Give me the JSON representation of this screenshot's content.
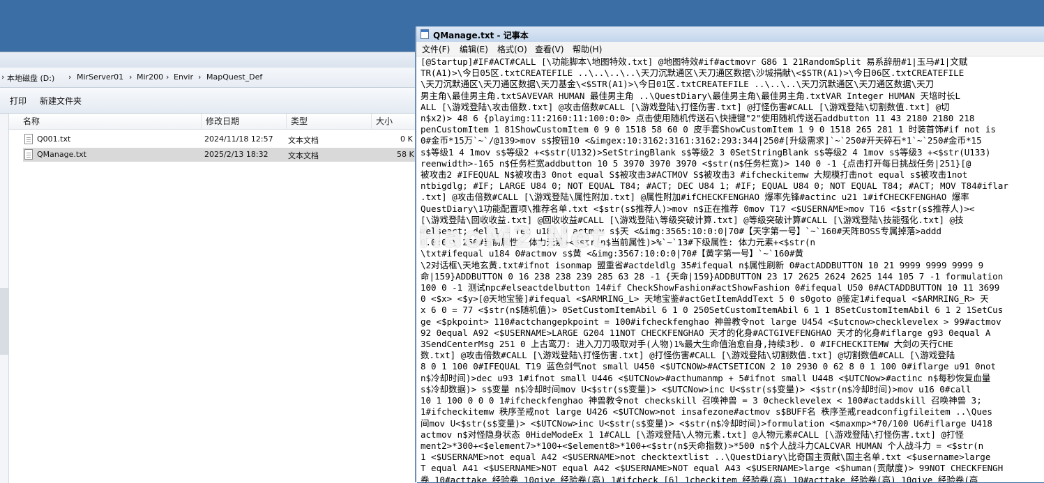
{
  "explorer": {
    "breadcrumb": [
      "本地磁盘 (D:)",
      "MirServer01",
      "Mir200",
      "Envir",
      "MapQuest_Def"
    ],
    "toolbar": {
      "print": "打印",
      "new_folder": "新建文件夹"
    },
    "columns": {
      "name": "名称",
      "date": "修改日期",
      "type": "类型",
      "size": "大小"
    },
    "files": [
      {
        "name": "Q001.txt",
        "date": "2024/11/18 12:57",
        "type": "文本文档",
        "size": "0 K"
      },
      {
        "name": "QManage.txt",
        "date": "2025/2/13 18:32",
        "type": "文本文档",
        "size": "58 K"
      }
    ]
  },
  "notepad": {
    "title": "QManage.txt - 记事本",
    "menu": [
      "文件(F)",
      "编辑(E)",
      "格式(O)",
      "查看(V)",
      "帮助(H)"
    ],
    "lines": [
      "[@Startup]#IF#ACT#CALL [\\功能脚本\\地图特效.txt] @地图特效#if#actmovr G86 1 21RandomSplit 易系辞册#1|玉马#1|文赋",
      "TR(A1)>\\今日05区.txtCREATEFILE ..\\..\\..\\..\\天刀沉默通区\\天刀通区数据\\沙城捐献\\<$STR(A1)>\\今日06区.txtCREATEFILE",
      "\\天刀沉默通区\\天刀通区数据\\天刀基金\\<$STR(A1)>\\今日01区.txtCREATEFILE ..\\..\\..\\天刀沉默通区\\天刀通区数据\\天刀",
      "男主角\\最佳男主角.txtSAVEVAR HUMAN 最佳男主角 ..\\QuestDiary\\最佳男主角\\最佳男主角.txtVAR Integer HUMAN 天培时长L",
      "ALL [\\游戏登陆\\攻击倍数.txt] @攻击倍数#CALL [\\游戏登陆\\打怪伤害.txt] @打怪伤害#CALL [\\游戏登陆\\切割数值.txt] @切",
      "n$x2)> 48 6 {playimg:11:2160:11:100:0:0> 点击使用随机传送石\\快捷键\"2\"使用随机传送石addbutton 11 43 2180 2180 218",
      "penCustomItem 1 81ShowCustomItem 0 9 0 1518 58 60 0 皮手套ShowCustomItem 1 9 0 1518 265 281 1 时装首饰#if not is",
      "0#金币*15万`~`/@139>mov s$按钮10 <&imgex:10:3162:3161:3162:293:344|250#[升级需求]`~`250#开天碎石*1`~`250#金币*15",
      "s$等级1 4 1mov s$等级2 +<$str(U132)>SetStringBlank s$等级2 3 0SetStringBlank s$等级2 4 1mov s$等级3 +<$str(U133)",
      "reenwidth>-165 n$任务栏宽addbutton 10 5 3970 3970 3970 <$str(n$任务栏宽)> 140 0 -1 {点击打开每日挑战任务|251}[@",
      "被攻击2 #IFEQUAL N$被攻击3 0not equal S$被攻击3#ACTMOV S$被攻击3 #ifcheckitemw 大规模打击not equal s$被攻击1not",
      "ntbigdlg; #IF; LARGE U84 0; NOT EQUAL T84; #ACT; DEC U84 1; #IF; EQUAL U84 0; NOT EQUAL T84; #ACT; MOV T84#iflar",
      ".txt] @攻击倍数#CALL [\\游戏登陆\\属性附加.txt] @属性附加#ifCHECKFENGHAO 爆率先锋#actinc u21 1#ifCHECKFENGHAO 爆率",
      "QuestDiary\\1功能配置项\\推荐名单.txt <$str(s$推荐人)>mov n$正在推荐 0mov T17 <$USERNAME>mov T16 <$str(s$推荐人)><",
      "[\\游戏登陆\\回收收益.txt] @回收收益#CALL [\\游戏登陆\\等级突破计算.txt] @等级突破计算#CALL [\\游戏登陆\\技能强化.txt] @技",
      "#elseact; del 1 4 fec u181 0 actmov s$天 <&img:3565:10:0:0|70#【天字第一号】`~`160#天阵BOSS专属掉落>addd",
      "0.0:0 \\ 250#当前属性: 体力元素+<$str(n$当前属性)>%`~`13#下级属性: 体力元素+<$str(n",
      "\\txt#ifequal u184 0#actmov s$黄 <&img:3567:10:0:0|70#【黄字第一号】`~`160#黄",
      "\\2对话框\\天地玄黄.txt#ifnot isonmap 盟重省#actdeldlg 35#ifequal n$属性刷新 0#actADDBUTTON 10 21 9999 9999 9999 9",
      "命|159}ADDBUTTON 0 16 238 238 239 285 63 28 -1 {天命|159}ADDBUTTON 23 17 2625 2624 2625 144 105 7 -1 formulation",
      "100 0 -1 测试npc#elseactdelbutton 14#if CheckShowFashion#actShowFashion 0#ifequal U50 0#ACTADDBUTTON 10 11 3699",
      "0 <$x> <$y>[@天地宝鉴]#ifequal <$ARMRING_L> 天地宝鉴#actGetItemAddText 5 0 s0goto @鉴定1#ifequal <$ARMRING_R> 天",
      "x 6 0 = 77 <$str(n$随机值)> 0SetCustomItemAbil 6 1 0 250SetCustomItemAbil 6 1 1 8SetCustomItemAbil 6 1 2 1SetCus",
      "ge <$pkpoint> 110#actchangepkpoint = 100#ifcheckfenghao 神兽教令not large U454 <$utcnow>checklevelex > 99#actmov",
      "92 0equal A92 <$USERNAME>LARGE G204 11NOT CHECKFENGHAO 天才的化身#ACTGIVEFENGHAO 天才的化身#iflarge g93 0equal A",
      "3SendCenterMsg 251 0 上古鸾刀: 进入刀刀吸取对手(人物)1%最大生命值治愈自身,持续3秒. 0 #IFCHECKITEMW 大剑の天行CHE",
      "数.txt] @攻击倍数#CALL [\\游戏登陆\\打怪伤害.txt] @打怪伤害#CALL [\\游戏登陆\\切割数值.txt] @切割数值#CALL [\\游戏登陆",
      "8 0 1 100 0#IFEQUAL T19 蓝色剑气not small U450 <$UTCNOW>#ACTSETICON 2 10 2930 0 62 8 0 1 100 0#iflarge u91 0not",
      "n$冷却时间)>dec u93 1#ifnot small U446 <$UTCNow>#acthumanmp + 5#ifnot small U448 <$UTCNow>#actinc n$每秒恢复血量",
      "s$冷却数据)> s$变量 n$冷却时间mov U<$str(s$变量)> <$UTCNow>inc U<$str(s$变量)> <$str(n$冷却时间)>mov u16 0#call",
      "10 1 100 0 0 0 1#ifcheckfenghao 神兽教令not checkskill 召唤神兽 = 3 0checklevelex < 100#actaddskill 召唤神兽 3;",
      "1#ifcheckitemw 秩序圣戒not large U426 <$UTCNow>not insafezone#actmov s$BUFF名 秩序圣戒readconfigfileitem ..\\Ques",
      "间mov U<$str(s$变量)> <$UTCNow>inc U<$str(s$变量)> <$str(n$冷却时间)>formulation <$maxmp>*70/100 U6#iflarge U418",
      "actmov n$对怪隐身状态 0HideModeEx 1 1#CALL [\\游戏登陆\\人物元素.txt] @人物元素#CALL [\\游戏登陆\\打怪伤害.txt] @打怪",
      "ment2>*300+<$element7>*100+<$element8>*100+<$str(n$天命指数)>*500 n$个人战斗力CALCVAR HUMAN 个人战斗力 = <$str(n",
      "1 <$USERNAME>not equal A42 <$USERNAME>not checktextlist ..\\QuestDiary\\比奇国主贡献\\国主名单.txt <$username>large",
      "T equal A41 <$USERNAME>NOT equal A42 <$USERNAME>NOT equal A43 <$USERNAME>large <$human(贡献度)> 99NOT CHECKFENGH",
      "卷 10#acttake 经验卷 10give 经验卷(高) 1#ifcheck [6] 1checkitem 经验卷(高) 10#acttake 经验卷(高) 10give 经验卷(高"
    ]
  },
  "watermark": "HaoM2.Net"
}
